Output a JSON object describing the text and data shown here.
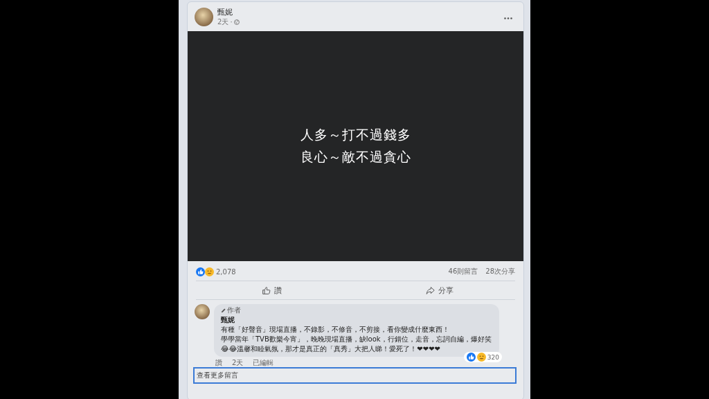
{
  "post": {
    "author": "甄妮",
    "time": "2天",
    "separator": "·",
    "image_text": [
      "人多～打不過錢多",
      "良心～敵不過貪心"
    ],
    "reactions_count": "2,078",
    "comments_count": "46則留言",
    "shares_count": "28次分享",
    "actions": [
      {
        "kind": "like",
        "label": "讚"
      },
      {
        "kind": "share",
        "label": "分享"
      }
    ]
  },
  "comment": {
    "badge": "作者",
    "author": "甄妮",
    "lines": [
      "有種「好聲音」現場直播，不錄影，不修音，不剪接，看你變成什麼東西！",
      "學學當年「TVB歡樂今宵」，晚晚現場直播，缺look，行錯位，走音，忘詞自編，爆好笑😂😂溫馨和睦氣氛，那才是真正的「真秀」大把人睇！愛死了！❤❤❤❤"
    ],
    "reaction_count": "320",
    "footer": [
      "讚",
      "2天",
      "已編輯"
    ]
  },
  "more_comments": "查看更多留言"
}
